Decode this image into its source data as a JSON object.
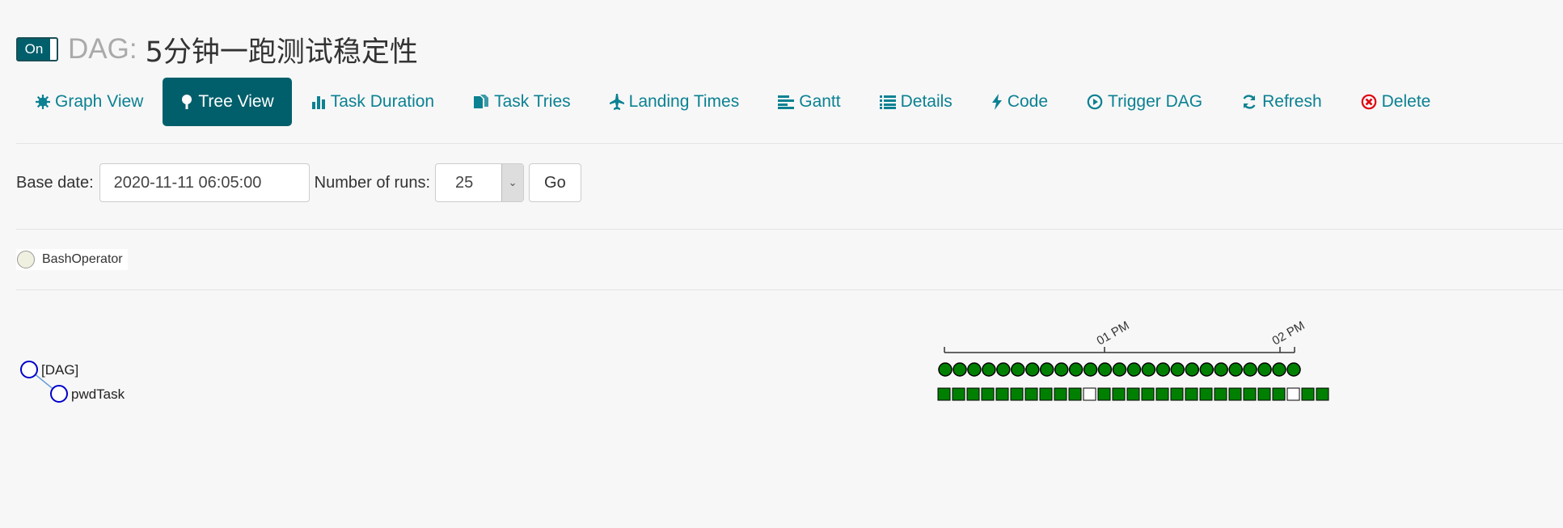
{
  "title": {
    "toggle_label": "On",
    "dag_prefix": "DAG:",
    "dag_name": "5分钟一跑测试稳定性"
  },
  "nav": {
    "graph_view": "Graph View",
    "tree_view": "Tree View",
    "task_duration": "Task Duration",
    "task_tries": "Task Tries",
    "landing_times": "Landing Times",
    "gantt": "Gantt",
    "details": "Details",
    "code": "Code",
    "trigger_dag": "Trigger DAG",
    "refresh": "Refresh",
    "delete": "Delete"
  },
  "form": {
    "base_date_label": "Base date:",
    "base_date_value": "2020-11-11 06:05:00",
    "num_runs_label": "Number of runs:",
    "num_runs_value": "25",
    "go_label": "Go"
  },
  "legend": {
    "operator": "BashOperator"
  },
  "tree": {
    "root_label": "[DAG]",
    "task_label": "pwdTask",
    "time_ticks": [
      "01 PM",
      "02 PM"
    ],
    "run_states": [
      "success",
      "success",
      "success",
      "success",
      "success",
      "success",
      "success",
      "success",
      "success",
      "success",
      "success",
      "success",
      "success",
      "success",
      "success",
      "success",
      "success",
      "success",
      "success",
      "success",
      "success",
      "success",
      "success",
      "success",
      "success"
    ],
    "task_states": [
      "success",
      "success",
      "success",
      "success",
      "success",
      "success",
      "success",
      "success",
      "success",
      "success",
      "none",
      "success",
      "success",
      "success",
      "success",
      "success",
      "success",
      "success",
      "success",
      "success",
      "success",
      "success",
      "success",
      "success",
      "none",
      "success",
      "success"
    ]
  },
  "colors": {
    "accent": "#005f6b",
    "link": "#0b8192",
    "success": "#008000",
    "delete_icon": "#e0000f"
  }
}
